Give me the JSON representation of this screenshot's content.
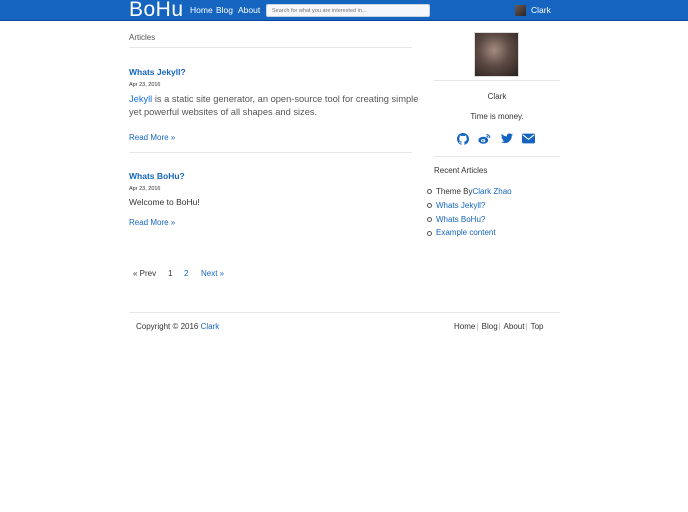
{
  "navbar": {
    "brand": "BoHu",
    "links": [
      "Home",
      "Blog",
      "About"
    ],
    "search_placeholder": "Search for what you are interested in...",
    "user_name": "Clark",
    "bg_color": "#1565c0"
  },
  "main": {
    "section_title": "Articles",
    "posts": [
      {
        "title": "Whats Jekyll?",
        "date": "Apr 23, 2016",
        "excerpt_link": "Jekyll",
        "excerpt_line1_rest": " is a static site generator, an open-source tool for creating simple",
        "excerpt_line2": "yet powerful websites of all shapes and sizes.",
        "read_more": "Read More »"
      },
      {
        "title": "Whats BoHu?",
        "date": "Apr 23, 2016",
        "excerpt": "Welcome to BoHu!",
        "read_more": "Read More »"
      }
    ],
    "pagination": {
      "prev": "« Prev",
      "pages": [
        "1",
        "2"
      ],
      "next": "Next »"
    }
  },
  "sidebar": {
    "name": "Clark",
    "motto": "Time is money.",
    "social_icons": [
      "github-icon",
      "weibo-icon",
      "twitter-icon",
      "mail-icon"
    ],
    "recent_title": "Recent Articles",
    "recent": [
      {
        "prefix": "Theme By ",
        "link": "Clark Zhao"
      },
      {
        "prefix": "",
        "link": "Whats Jekyll?"
      },
      {
        "prefix": "",
        "link": "Whats BoHu?"
      },
      {
        "prefix": "",
        "link": "Example content"
      }
    ]
  },
  "footer": {
    "copyright": "Copyright © 2016 ",
    "author_link": "Clark",
    "links": [
      "Home",
      "Blog",
      "About",
      "Top"
    ],
    "separator": "|"
  },
  "colors": {
    "accent": "#1565c0",
    "text": "#333333",
    "divider": "#e7e7e7"
  }
}
